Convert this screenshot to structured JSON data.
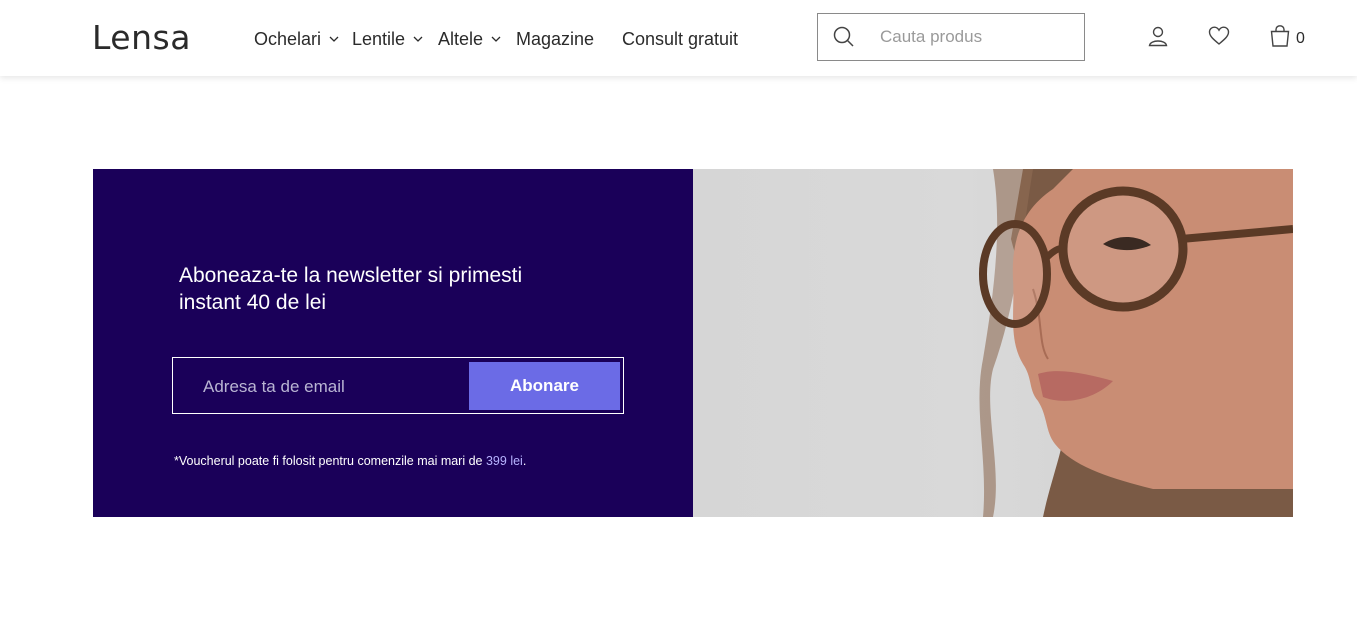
{
  "header": {
    "logo": "Lensa",
    "nav": [
      {
        "label": "Ochelari",
        "dropdown": true
      },
      {
        "label": "Lentile",
        "dropdown": true
      },
      {
        "label": "Altele",
        "dropdown": true
      },
      {
        "label": "Magazine",
        "dropdown": false
      },
      {
        "label": "Consult gratuit",
        "dropdown": false
      }
    ],
    "search": {
      "placeholder": "Cauta produs",
      "icon": "search-icon"
    },
    "icons": {
      "account": "user-icon",
      "wishlist": "heart-icon",
      "cart": "bag-icon"
    },
    "cart_count": "0"
  },
  "newsletter": {
    "headline": "Aboneaza-te la newsletter si primesti instant 40 de lei",
    "email_placeholder": "Adresa ta de email",
    "button_label": "Abonare",
    "note_prefix": "*Voucherul poate fi folosit pentru comenzile mai mari de ",
    "note_amount": "399 lei",
    "note_suffix": ".",
    "colors": {
      "panel": "#1a0059",
      "button": "#6b6be6",
      "highlight": "#b7b3ff"
    }
  },
  "hero_image": {
    "subject": "woman-wearing-glasses-photo"
  }
}
